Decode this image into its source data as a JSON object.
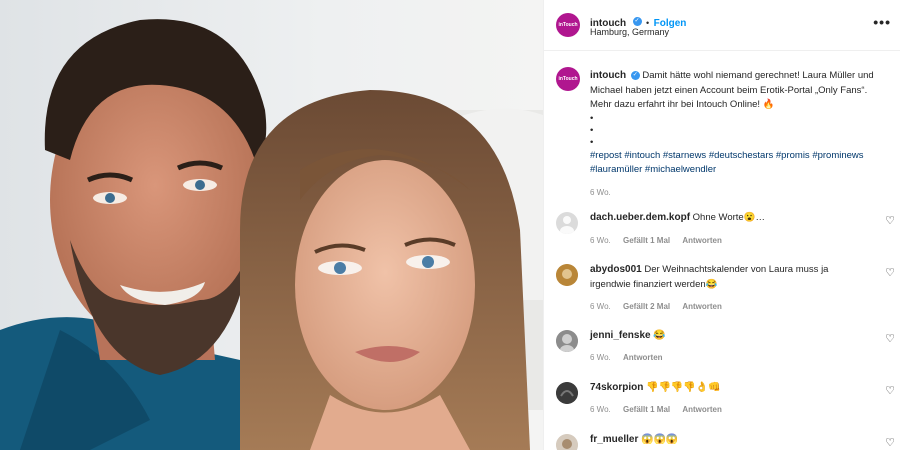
{
  "post": {
    "username": "intouch",
    "follow_label": "Folgen",
    "location": "Hamburg, Germany",
    "more_icon": "•••",
    "brand_logo_text": "inTouch"
  },
  "caption": {
    "username": "intouch",
    "text": "Damit hätte wohl niemand gerechnet! Laura Müller und Michael haben jetzt einen Account beim Erotik-Portal „Only Fans“. Mehr dazu erfahrt ihr bei Intouch Online! 🔥",
    "dot1": "•",
    "dot2": "•",
    "dot3": "•",
    "hashtags": "#repost #intouch #starnews #deutschestars #promis #prominews #lauramüller #michaelwendler",
    "time": "6 Wo."
  },
  "comments": [
    {
      "username": "dach.ueber.dem.kopf",
      "text": "Ohne Worte😮…",
      "time": "6 Wo.",
      "likes": "Gefällt 1 Mal",
      "reply": "Antworten"
    },
    {
      "username": "abydos001",
      "text": "Der Weihnachtskalender von Laura muss ja irgendwie finanziert werden😂",
      "time": "6 Wo.",
      "likes": "Gefällt 2 Mal",
      "reply": "Antworten"
    },
    {
      "username": "jenni_fenske",
      "text": "😂",
      "time": "6 Wo.",
      "reply": "Antworten"
    },
    {
      "username": "74skorpion",
      "text": "👎👎👎👎👌👊",
      "time": "6 Wo.",
      "likes": "Gefällt 1 Mal",
      "reply": "Antworten"
    },
    {
      "username": "fr_mueller",
      "text": "😱😱😱",
      "time": ""
    }
  ],
  "icons": {
    "heart": "♡",
    "verified": "✓"
  },
  "colors": {
    "brand": "#b0168f",
    "verified": "#3897f0",
    "link": "#0095f6",
    "hashtag": "#00376b",
    "meta": "#8e8e8e"
  }
}
